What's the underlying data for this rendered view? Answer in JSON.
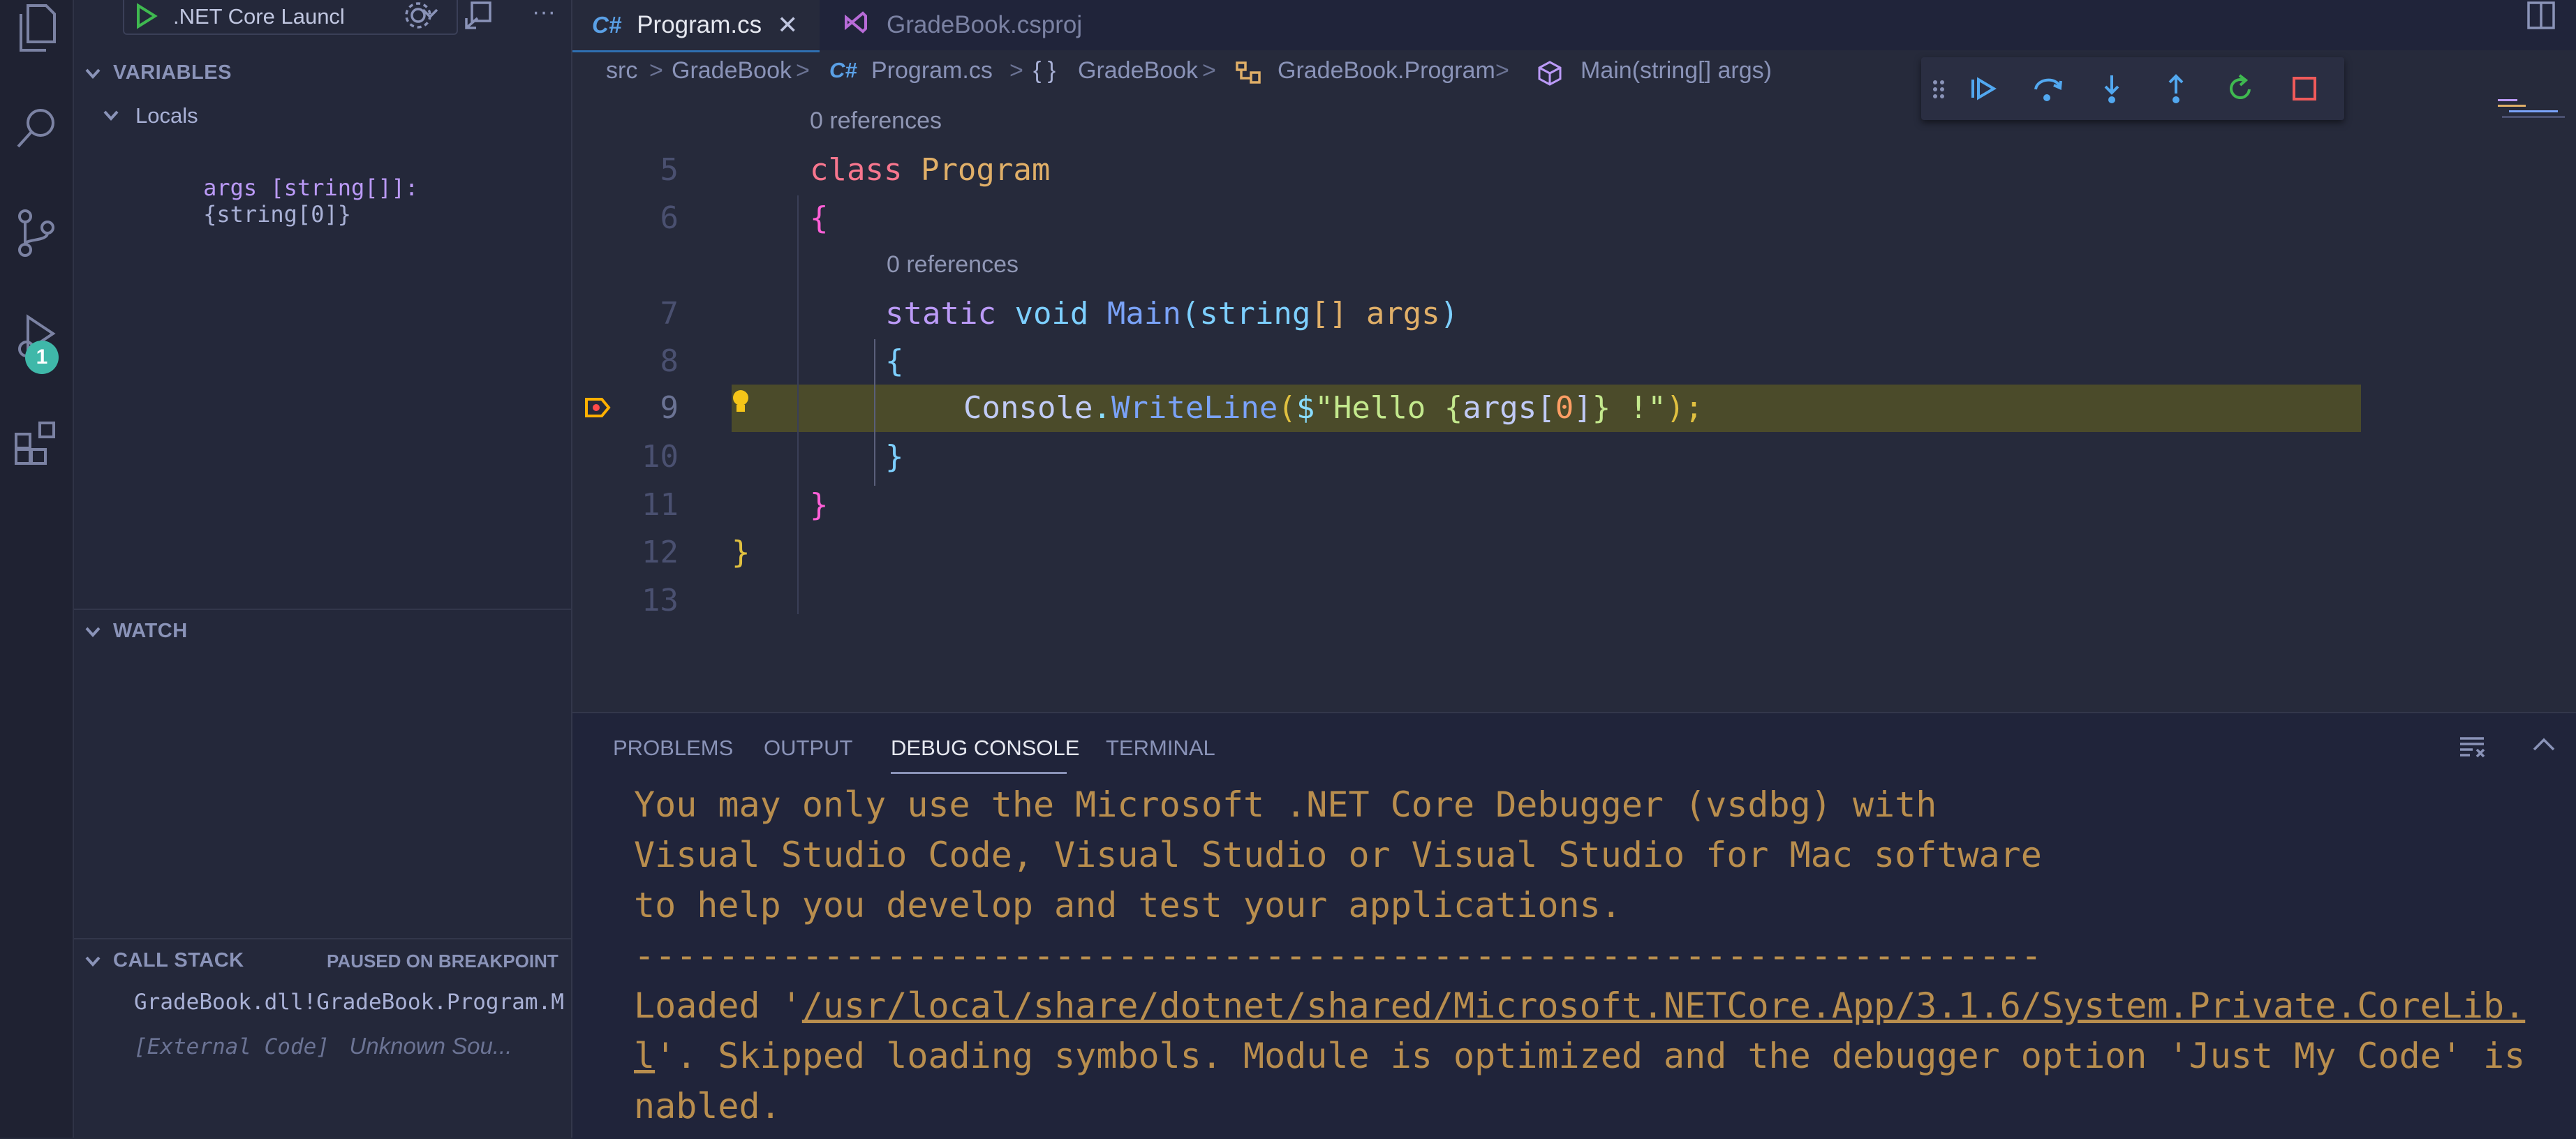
{
  "debug_config": {
    "run_label": ".NET Core Launcl"
  },
  "activity": {
    "debug_badge": "1"
  },
  "sidebar": {
    "variables": {
      "title": "VARIABLES",
      "locals_label": "Locals",
      "items": [
        {
          "name": "args [string[]]:",
          "value": "{string[0]}"
        }
      ]
    },
    "watch": {
      "title": "WATCH"
    },
    "call_stack": {
      "title": "CALL STACK",
      "status": "PAUSED ON BREAKPOINT",
      "frames": [
        {
          "name": "GradeBook.dll!GradeBook.Program.M",
          "source": ""
        },
        {
          "name": "[External Code]",
          "source": "Unknown Sou..."
        }
      ]
    }
  },
  "tabs": [
    {
      "lang": "C#",
      "label": "Program.cs",
      "active": true
    },
    {
      "lang": "",
      "label": "GradeBook.csproj",
      "active": false
    }
  ],
  "breadcrumb": {
    "items": [
      "src",
      "GradeBook",
      "Program.cs",
      "GradeBook",
      "GradeBook.Program",
      "Main(string[] args)"
    ],
    "cs_prefix": "C#",
    "ns_prefix": "{ }"
  },
  "editor": {
    "refs_class": "0 references",
    "refs_main": "0 references",
    "lines": [
      {
        "n": "5"
      },
      {
        "n": "6"
      },
      {
        "n": "7"
      },
      {
        "n": "8"
      },
      {
        "n": "9"
      },
      {
        "n": "10"
      },
      {
        "n": "11"
      },
      {
        "n": "12"
      },
      {
        "n": "13"
      }
    ],
    "code": {
      "l5_kw": "class",
      "l5_name": "Program",
      "l6": "{",
      "l7_static": "static",
      "l7_void": "void",
      "l7_main": "Main",
      "l7_open": "(",
      "l7_type": "string",
      "l7_br": "[]",
      "l7_args": "args",
      "l7_close": ")",
      "l8": "{",
      "l9_console": "Console",
      "l9_dot": ".",
      "l9_method": "WriteLine",
      "l9_open": "(",
      "l9_dollar": "$",
      "l9_str1": "\"Hello ",
      "l9_brace_o": "{",
      "l9_args": "args",
      "l9_idx_o": "[",
      "l9_zero": "0",
      "l9_idx_c": "]",
      "l9_brace_c": "}",
      "l9_str2": " !\"",
      "l9_close": ");",
      "l10": "}",
      "l11": "}",
      "l12": "}"
    }
  },
  "panel": {
    "tabs": [
      "PROBLEMS",
      "OUTPUT",
      "DEBUG CONSOLE",
      "TERMINAL"
    ],
    "active_tab": "DEBUG CONSOLE",
    "console": [
      "You may only use the Microsoft .NET Core Debugger (vsdbg) with",
      "Visual Studio Code, Visual Studio or Visual Studio for Mac software",
      "to help you develop and test your applications.",
      "-------------------------------------------------------------------"
    ],
    "loaded_prefix": "Loaded '",
    "loaded_path": "/usr/local/share/dotnet/shared/Microsoft.NETCore.App/3.1.6/System.Private.CoreLib.",
    "wrap_char": "l",
    "loaded_suffix": "'. Skipped loading symbols. Module is optimized and the debugger option 'Just My Code' is",
    "last_line": "nabled."
  },
  "colors": {
    "keyword": "#bb9af7",
    "type_name": "#e0af68",
    "function": "#7aa2f7",
    "string": "#9ece6a",
    "number": "#ff9e64",
    "brace_outer": "#e0c040",
    "brace_inner": "#c678dd",
    "brace_deep": "#7dcfff",
    "console": "#b98e4e",
    "highlight": "#4b4b2a"
  }
}
